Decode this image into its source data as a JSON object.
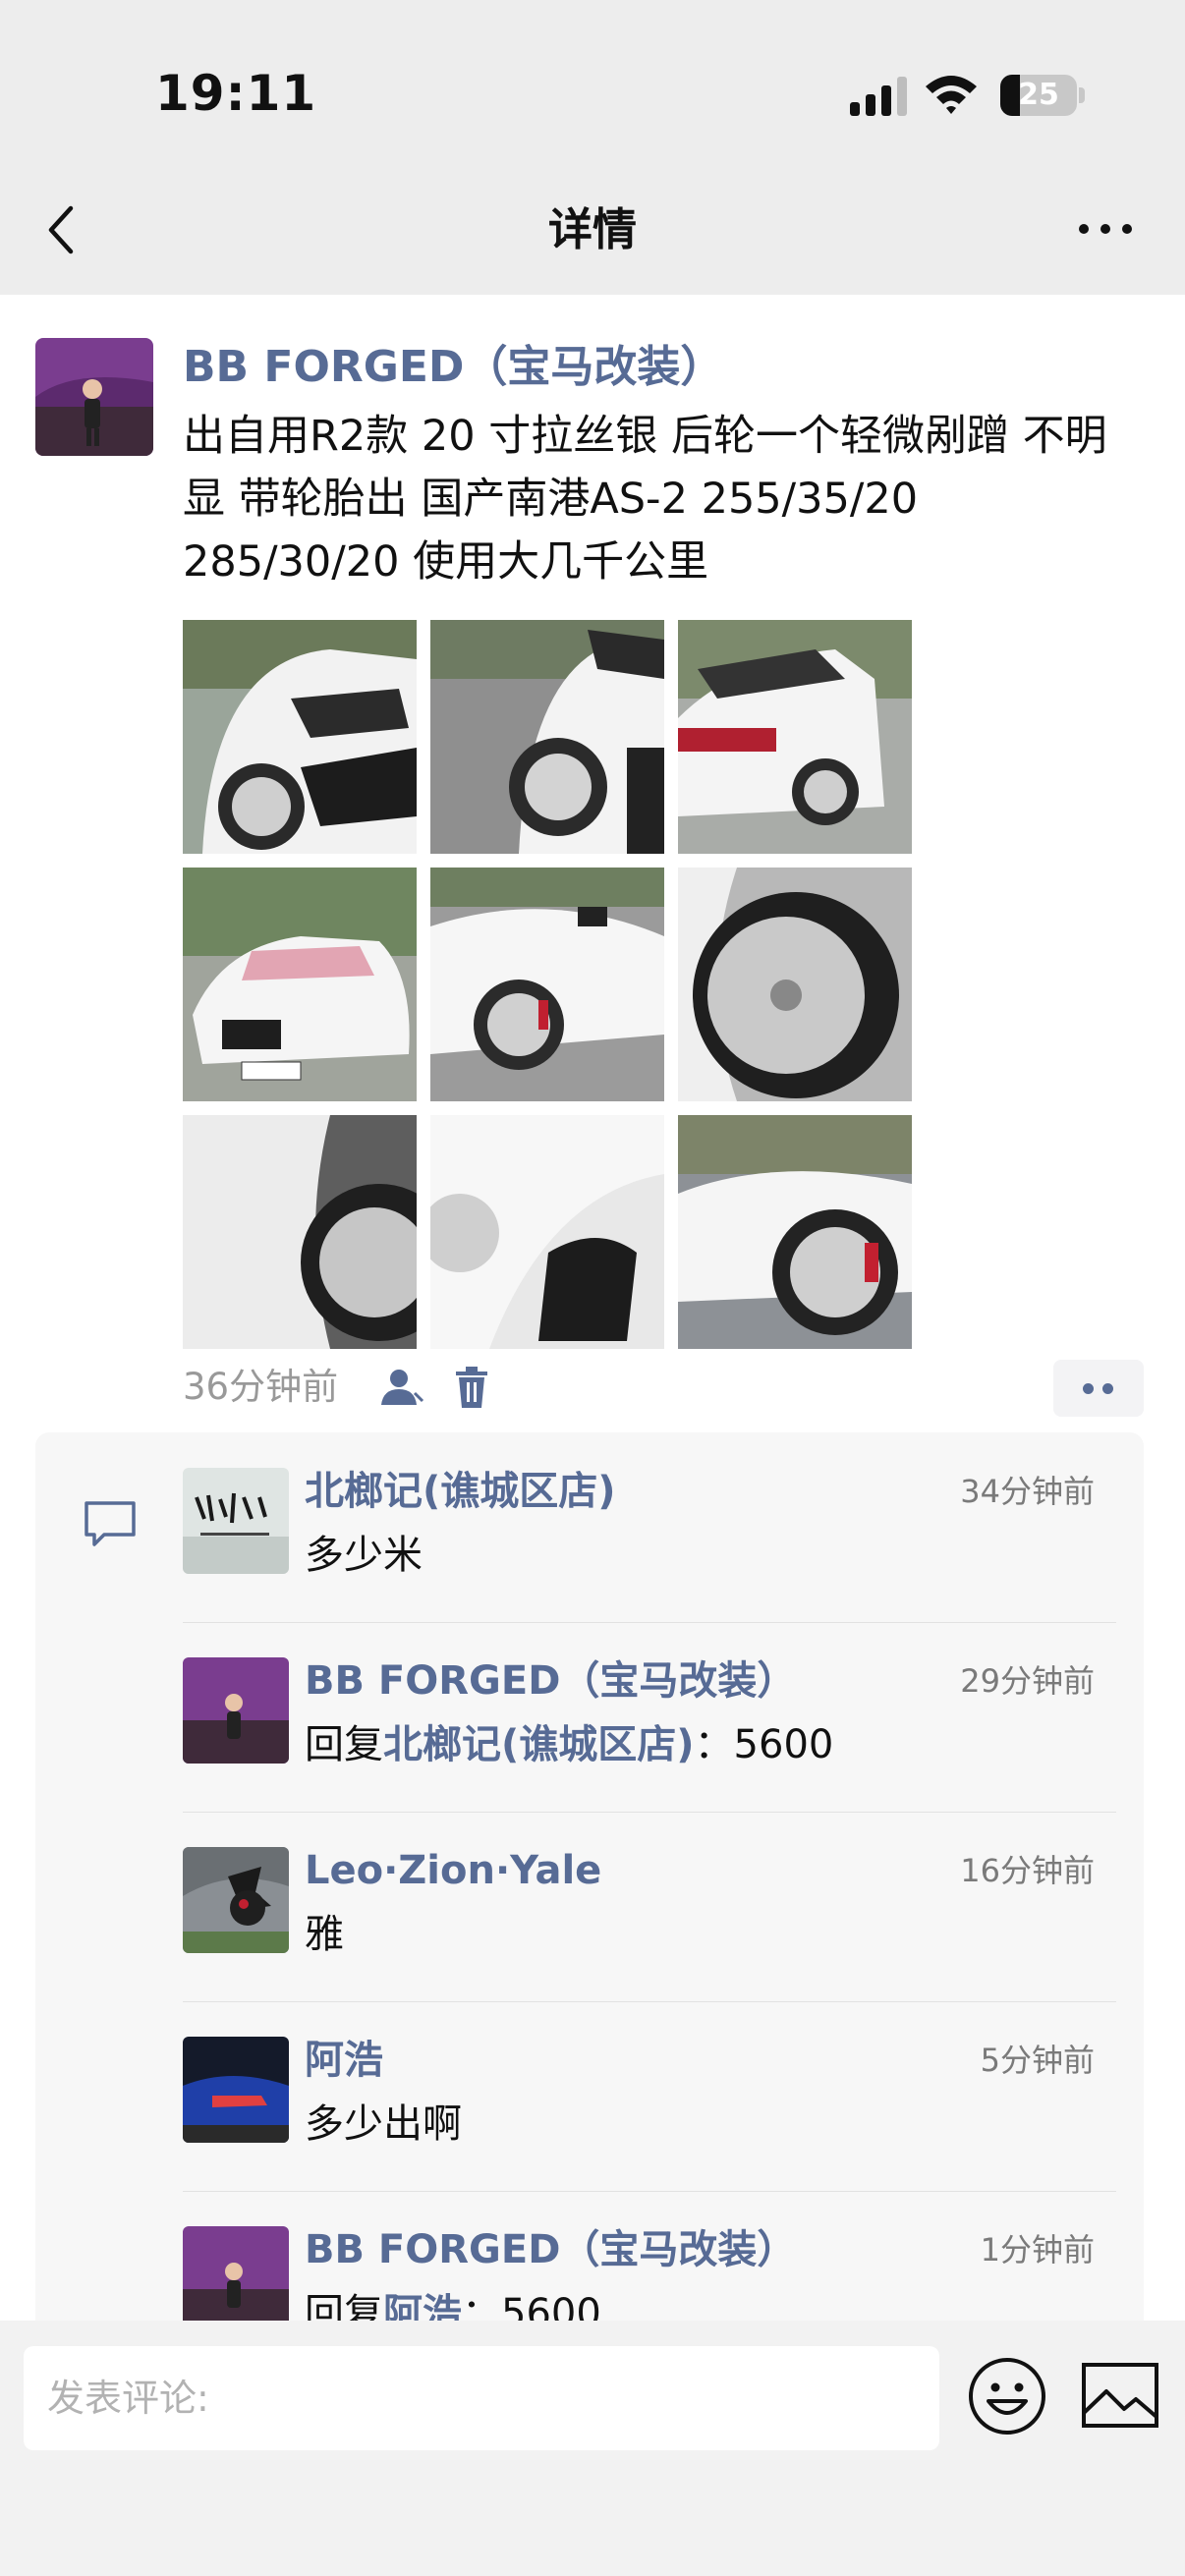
{
  "status_bar": {
    "time": "19:11",
    "battery": "25",
    "battery_level": 0.25
  },
  "nav": {
    "title": "详情"
  },
  "post": {
    "author": "BB FORGED（宝马改装）",
    "text": "出自用R2款 20 寸拉丝银 后轮一个轻微剐蹭 不明显  带轮胎出 国产南港AS-2 255/35/20 285/30/20 使用大几千公里",
    "time": "36分钟前"
  },
  "comments": [
    {
      "name": "北榔记(谯城区店)",
      "time": "34分钟前",
      "text": "多少米"
    },
    {
      "name": "BB FORGED（宝马改装）",
      "time": "29分钟前",
      "reply_prefix": "回复",
      "reply_to": "北榔记(谯城区店)",
      "reply_text": "：5600"
    },
    {
      "name": "Leo·Zion·Yale",
      "time": "16分钟前",
      "text": "雅"
    },
    {
      "name": "阿浩",
      "time": "5分钟前",
      "text": "多少出啊"
    },
    {
      "name": "BB FORGED（宝马改装）",
      "time": "1分钟前",
      "reply_prefix": "回复",
      "reply_to": "阿浩",
      "reply_text": "：5600"
    }
  ],
  "input": {
    "placeholder": "发表评论:"
  },
  "colors": {
    "link": "#576b95",
    "background": "#ededed",
    "comment_bg": "#f7f7f7"
  },
  "icons": [
    "back-icon",
    "more-icon",
    "user-icon",
    "trash-icon",
    "comment-icon",
    "emoji-icon",
    "image-icon"
  ]
}
